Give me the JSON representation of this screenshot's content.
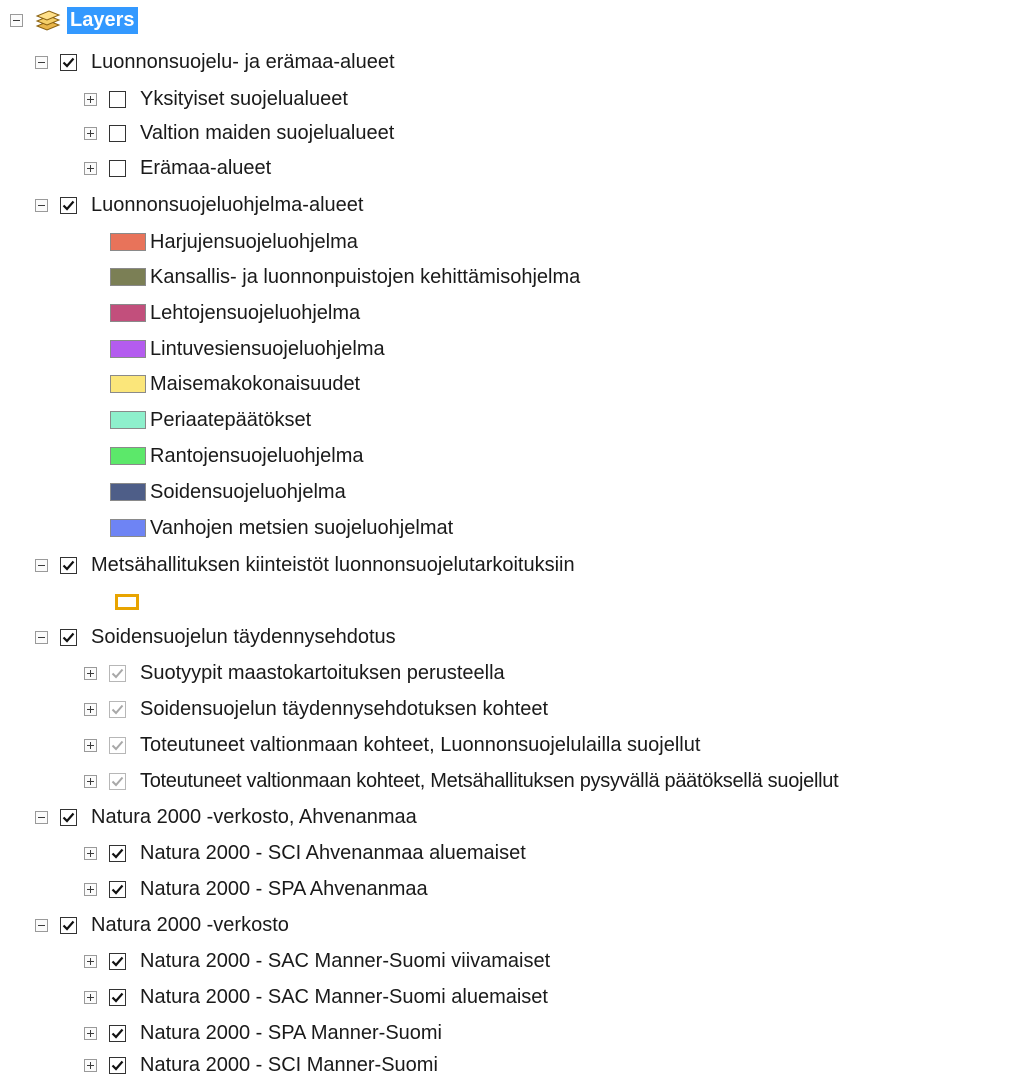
{
  "toc": {
    "root": {
      "label": "Layers",
      "expander": "minus",
      "icon": "layers-stack-icon"
    },
    "groups": [
      {
        "label": "Luonnonsuojelu- ja erämaa-alueet",
        "checked": true
      },
      {
        "label": "Yksityiset suojelualueet",
        "checked": false
      },
      {
        "label": "Valtion maiden suojelualueet",
        "checked": false
      },
      {
        "label": "Erämaa-alueet",
        "checked": false
      },
      {
        "label": "Luonnonsuojeluohjelma-alueet",
        "checked": true
      },
      {
        "label": "Metsähallituksen kiinteistöt luonnonsuojelutarkoituksiin",
        "checked": true
      },
      {
        "label": "Soidensuojelun täydennysehdotus",
        "checked": true
      },
      {
        "label": "Suotyypit maastokartoituksen perusteella",
        "checked": true
      },
      {
        "label": "Soidensuojelun täydennysehdotuksen kohteet",
        "checked": true
      },
      {
        "label": "Toteutuneet valtionmaan kohteet,  Luonnonsuojelulailla suojellut",
        "checked": true
      },
      {
        "label": "Toteutuneet valtionmaan kohteet, Metsähallituksen pysyvällä päätöksellä suojellut",
        "checked": true
      },
      {
        "label": "Natura 2000 -verkosto, Ahvenanmaa",
        "checked": true
      },
      {
        "label": "Natura 2000 - SCI Ahvenanmaa aluemaiset",
        "checked": true
      },
      {
        "label": "Natura 2000 - SPA Ahvenanmaa",
        "checked": true
      },
      {
        "label": "Natura 2000 -verkosto",
        "checked": true
      },
      {
        "label": "Natura 2000 - SAC Manner-Suomi viivamaiset",
        "checked": true
      },
      {
        "label": "Natura 2000 - SAC Manner-Suomi aluemaiset",
        "checked": true
      },
      {
        "label": "Natura 2000 - SPA Manner-Suomi",
        "checked": true
      },
      {
        "label": "Natura 2000 - SCI  Manner-Suomi",
        "checked": true
      }
    ],
    "legend": [
      {
        "label": "Harjujensuojeluohjelma",
        "color": "#e8735a"
      },
      {
        "label": "Kansallis- ja luonnonpuistojen kehittämisohjelma",
        "color": "#7b7f55"
      },
      {
        "label": "Lehtojensuojeluohjelma",
        "color": "#c24f7c"
      },
      {
        "label": "Lintuvesiensuojeluohjelma",
        "color": "#b45cef"
      },
      {
        "label": "Maisemakokonaisuudet",
        "color": "#fbe67a"
      },
      {
        "label": "Periaatepäätökset",
        "color": "#8ef0cc"
      },
      {
        "label": "Rantojensuojeluohjelma",
        "color": "#5ce86a"
      },
      {
        "label": "Soidensuojeluohjelma",
        "color": "#4e5e88"
      },
      {
        "label": "Vanhojen metsien suojeluohjelmat",
        "color": "#6e84f4"
      }
    ],
    "hollow_symbol_color": "#e8a400",
    "selection_color": "#3399ff"
  }
}
